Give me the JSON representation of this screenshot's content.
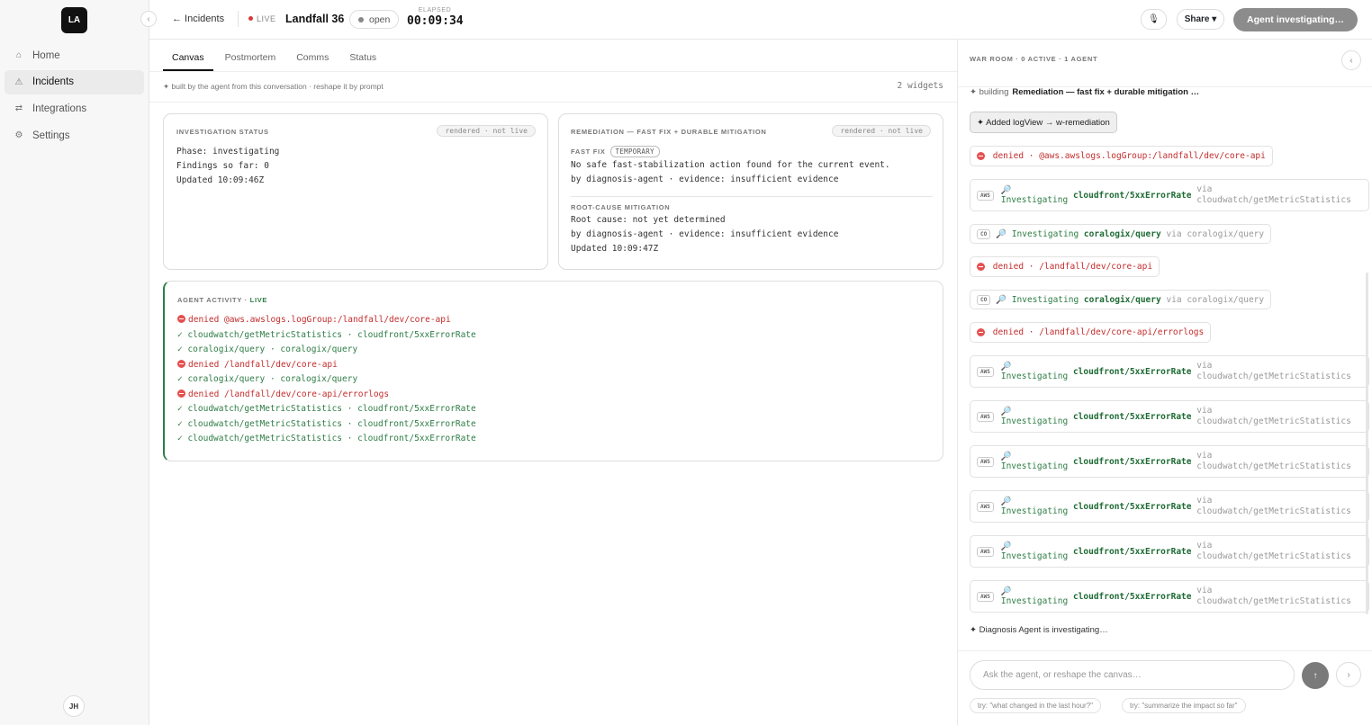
{
  "sidebar": {
    "logo": "LA",
    "collapse_icon": "‹",
    "items": [
      {
        "label": "Home",
        "icon": "⌂"
      },
      {
        "label": "Incidents",
        "icon": "⚠"
      },
      {
        "label": "Integrations",
        "icon": "⇄"
      },
      {
        "label": "Settings",
        "icon": "⚙"
      }
    ],
    "user_initials": "JH"
  },
  "topbar": {
    "back_label": "← Incidents",
    "live_label": "LIVE",
    "incident_title": "Landfall 36",
    "status": "open",
    "elapsed_label": "ELAPSED",
    "elapsed_value": "00:09:34",
    "mic_icon": "🎙",
    "share_label": "Share ▾",
    "agent_button": "Agent investigating…"
  },
  "main": {
    "tabs": [
      {
        "label": "Canvas"
      },
      {
        "label": "Postmortem"
      },
      {
        "label": "Comms"
      },
      {
        "label": "Status"
      }
    ],
    "subhead": "✦ built by the agent from this conversation · reshape it by prompt",
    "widget_count": "2 widgets",
    "investigation": {
      "title": "INVESTIGATION STATUS",
      "badge": "rendered · not live",
      "lines": [
        "Phase: investigating",
        "Findings so far: 0",
        "Updated 10:09:46Z"
      ]
    },
    "remediation": {
      "title": "REMEDIATION — FAST FIX + DURABLE MITIGATION",
      "badge": "rendered · not live",
      "fast_fix_label": "FAST FIX",
      "temporary_badge": "TEMPORARY",
      "fast_fix_lines": [
        "No safe fast-stabilization action found for the current event.",
        "by diagnosis-agent · evidence: insufficient evidence"
      ],
      "root_cause_label": "ROOT-CAUSE MITIGATION",
      "root_cause_lines": [
        "Root cause: not yet determined",
        "by diagnosis-agent · evidence: insufficient evidence",
        "Updated 10:09:47Z"
      ]
    },
    "activity": {
      "title": "AGENT ACTIVITY · ",
      "live": "LIVE",
      "lines": [
        {
          "kind": "err",
          "text": "denied @aws.awslogs.logGroup:/landfall/dev/core-api"
        },
        {
          "kind": "ok",
          "text": "✓ cloudwatch/getMetricStatistics · cloudfront/5xxErrorRate"
        },
        {
          "kind": "ok",
          "text": "✓ coralogix/query · coralogix/query"
        },
        {
          "kind": "err",
          "text": "denied /landfall/dev/core-api"
        },
        {
          "kind": "ok",
          "text": "✓ coralogix/query · coralogix/query"
        },
        {
          "kind": "err",
          "text": "denied /landfall/dev/core-api/errorlogs"
        },
        {
          "kind": "ok",
          "text": "✓ cloudwatch/getMetricStatistics · cloudfront/5xxErrorRate"
        },
        {
          "kind": "ok",
          "text": "✓ cloudwatch/getMetricStatistics · cloudfront/5xxErrorRate"
        },
        {
          "kind": "ok",
          "text": "✓ cloudwatch/getMetricStatistics · cloudfront/5xxErrorRate"
        }
      ]
    }
  },
  "warroom": {
    "header": "WAR ROOM · 0 ACTIVE · 1 AGENT",
    "collapse_icon": "‹",
    "building_prefix": "✦ building",
    "building_target": "Remediation — fast fix + durable mitigation …",
    "added_chip": "✦ Added logView → w-remediation",
    "denied1": "denied · @aws.awslogs.logGroup:/landfall/dev/core-api",
    "denied2": "denied · /landfall/dev/core-api",
    "denied3": "denied · /landfall/dev/core-api/errorlogs",
    "aws_tag": "AWS",
    "co_tag": "CO",
    "magnifier_icon": "🔎",
    "investigating": "Investigating",
    "cf_metric": "cloudfront/5xxErrorRate",
    "via": "via",
    "cw_tool": "cloudwatch/getMetricStatistics",
    "cx_query": "coralogix/query",
    "cx_via": "via coralogix/query",
    "status_line": "✦ Diagnosis Agent is investigating…",
    "input_placeholder": "Ask the agent, or reshape the canvas…",
    "send_icon": "↑",
    "next_icon": "›",
    "suggestions": [
      "try: \"what changed in the last hour?\"",
      "try: \"summarize the impact so far\""
    ]
  }
}
